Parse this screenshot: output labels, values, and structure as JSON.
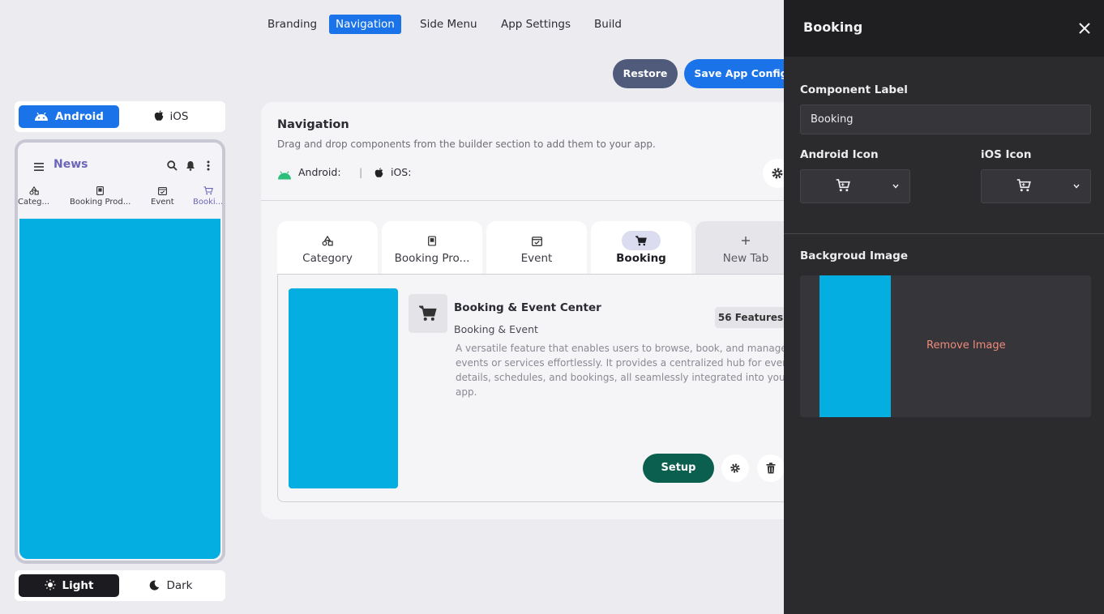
{
  "top_tabs": [
    "Branding",
    "Navigation",
    "Side Menu",
    "App Settings",
    "Build"
  ],
  "actions": {
    "restore": "Restore",
    "save": "Save App Config"
  },
  "platform_toggle": {
    "android": "Android",
    "ios": "iOS"
  },
  "phone": {
    "title": "News",
    "tabs": [
      "Categ...",
      "Booking Prod...",
      "Event",
      "Booki..."
    ]
  },
  "theme_toggle": {
    "light": "Light",
    "dark": "Dark"
  },
  "navigation": {
    "title": "Navigation",
    "subtitle": "Drag and drop components from the builder section to add them to your app.",
    "android_label": "Android:",
    "ios_label": "iOS:",
    "separator": "|",
    "tabs": [
      "Category",
      "Booking Pro...",
      "Event",
      "Booking",
      "New Tab"
    ]
  },
  "feature": {
    "name": "Booking & Event Center",
    "category": "Booking & Event",
    "badge": "56 Features",
    "description_lines": [
      "A versatile feature that enables users to browse, book, and manage",
      "events or services effortlessly. It provides a centralized hub for event",
      "details, schedules, and bookings, all seamlessly integrated into your",
      "app."
    ],
    "setup_label": "Setup"
  },
  "panel": {
    "title": "Booking",
    "component_label_title": "Component Label",
    "component_label_value": "Booking",
    "android_icon_label": "Android Icon",
    "ios_icon_label": "iOS Icon",
    "bg_image_label": "Backgroud Image",
    "remove_image": "Remove Image"
  },
  "colors": {
    "primary": "#1a73e8",
    "restore": "#505a7a",
    "setup": "#0b5f4f",
    "image_blue": "#04aee0",
    "phone_accent": "#6b66b8",
    "remove_text": "#f08a7a"
  }
}
